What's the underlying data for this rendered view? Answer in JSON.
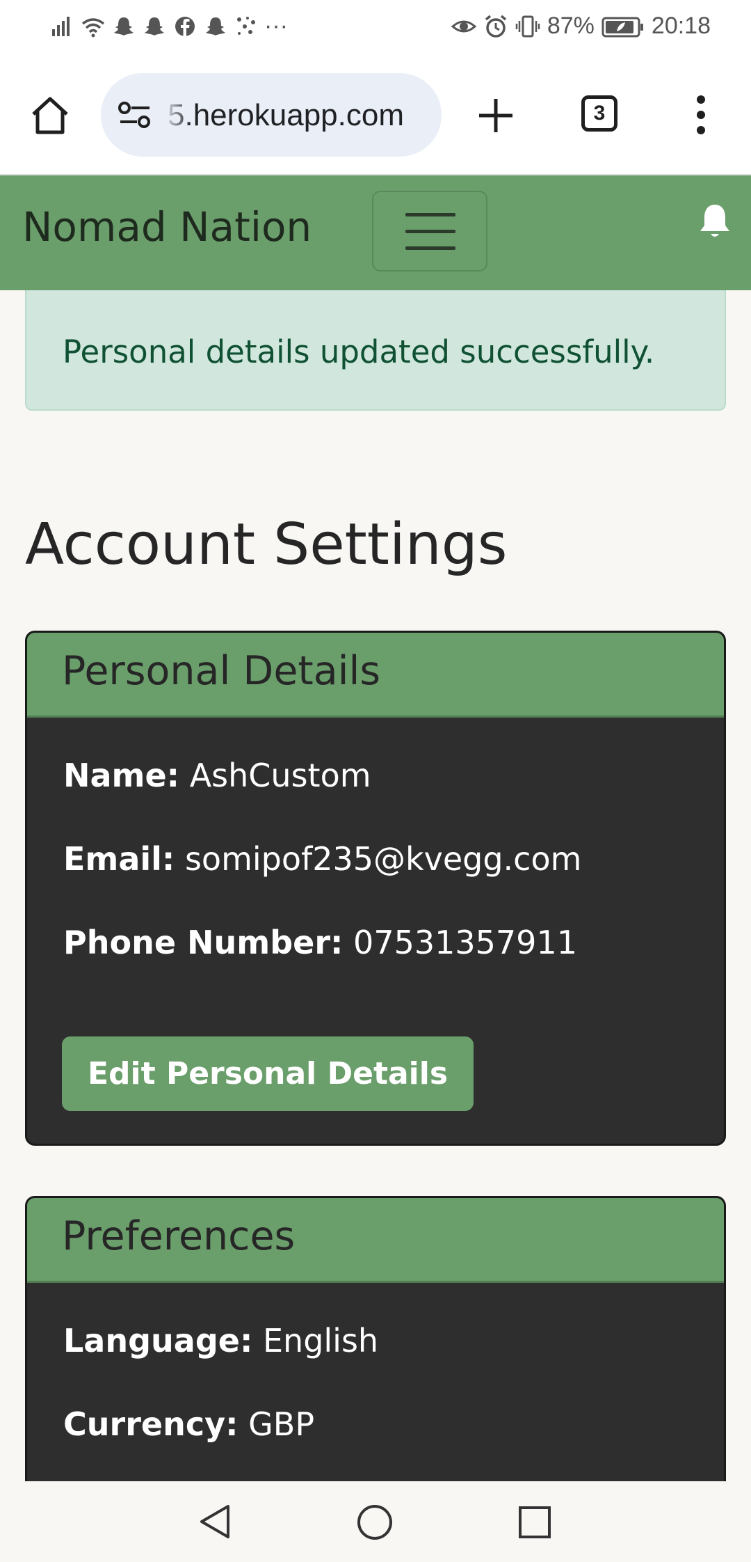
{
  "status_bar": {
    "notif_more": "···",
    "battery": "87%",
    "time": "20:18"
  },
  "browser": {
    "url": "5.herokuapp.com",
    "tab_count": "3"
  },
  "navbar": {
    "brand": "Nomad Nation"
  },
  "alert": {
    "message": "Personal details updated successfully."
  },
  "page": {
    "title": "Account Settings"
  },
  "personal_details": {
    "header": "Personal Details",
    "name_label": "Name:",
    "name_value": "AshCustom",
    "email_label": "Email:",
    "email_value": "somipof235@kvegg.com",
    "phone_label": "Phone Number:",
    "phone_value": "07531357911",
    "edit_button": "Edit Personal Details"
  },
  "preferences": {
    "header": "Preferences",
    "language_label": "Language:",
    "language_value": "English",
    "currency_label": "Currency:",
    "currency_value": "GBP"
  },
  "colors": {
    "brand_green": "#6a9e6b",
    "card_dark": "#2e2e2e",
    "alert_bg": "#d1e7dd",
    "alert_text": "#0f5132"
  }
}
